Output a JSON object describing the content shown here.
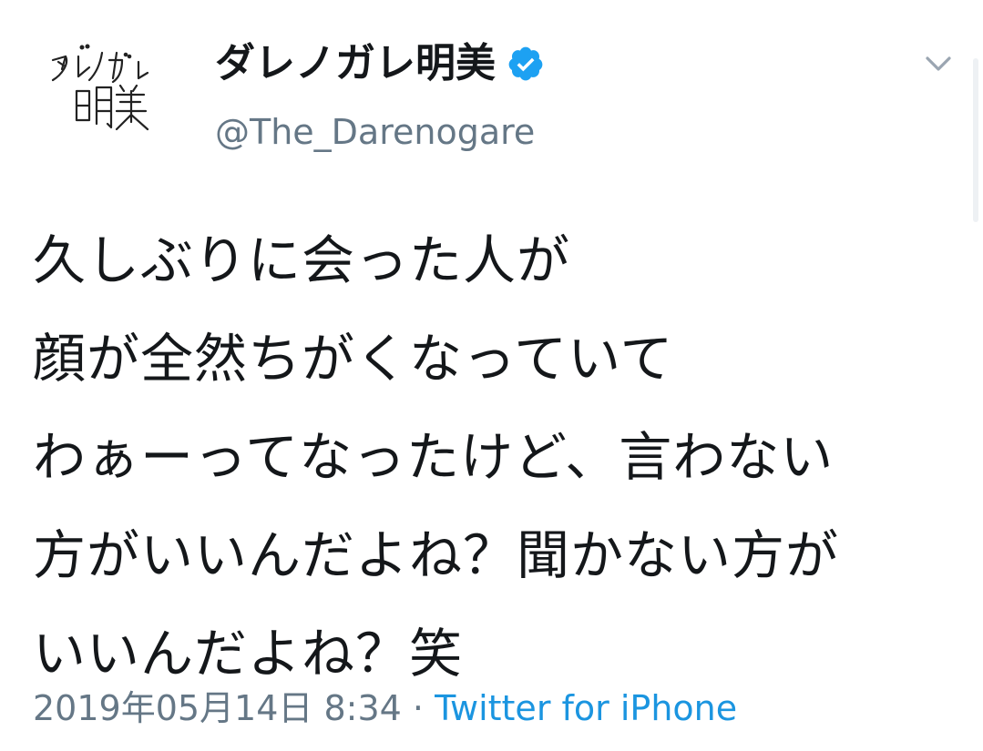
{
  "user": {
    "display_name": "ダレノガレ明美",
    "handle": "@The_Darenogare",
    "verified": true
  },
  "tweet": {
    "lines": [
      "久しぶりに会った人が",
      "顔が全然ちがくなっていて",
      "わぁーってなったけど、言わない",
      "方がいいんだよね？聞かない方が",
      "いいんだよね？笑"
    ],
    "timestamp": "2019年05月14日 8:34",
    "separator": " · ",
    "source": "Twitter for iPhone"
  },
  "icons": {
    "verified": "verified-badge-icon",
    "menu": "chevron-down-icon"
  },
  "colors": {
    "text": "#14171a",
    "secondary": "#657786",
    "accent": "#1b95e0",
    "verified": "#1da1f2"
  }
}
